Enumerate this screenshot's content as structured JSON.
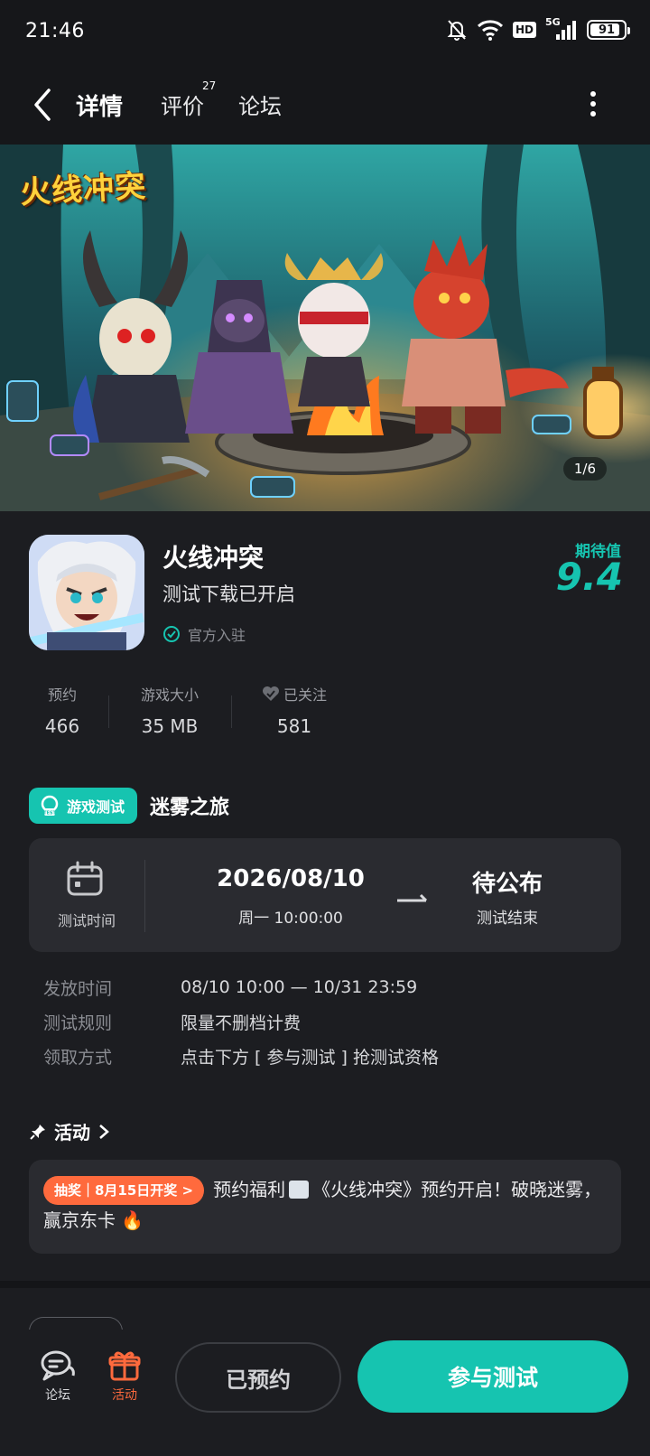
{
  "status_bar": {
    "time": "21:46",
    "network": "5G",
    "hd": "HD",
    "battery": "91"
  },
  "nav": {
    "tabs": [
      {
        "label": "详情",
        "active": true
      },
      {
        "label": "评价",
        "badge": "27"
      },
      {
        "label": "论坛"
      }
    ]
  },
  "banner": {
    "logo_text": "火线冲突",
    "page_indicator": "1/6"
  },
  "game": {
    "name": "火线冲突",
    "tagline": "测试下载已开启",
    "official_label": "官方入驻",
    "expect_label": "期待值",
    "expect_score": "9.4"
  },
  "stats": [
    {
      "label": "预约",
      "value": "466"
    },
    {
      "label": "游戏大小",
      "value": "35 MB"
    },
    {
      "label": "已关注",
      "value": "581"
    }
  ],
  "test": {
    "badge_label": "游戏测试",
    "badge_icon_text": "TEST",
    "name": "迷雾之旅",
    "time_label": "测试时间",
    "start_date": "2026/08/10",
    "start_time": "周一  10:00:00",
    "end_date": "待公布",
    "end_label": "测试结束",
    "rows": [
      {
        "key": "发放时间",
        "value": "08/10 10:00 — 10/31 23:59"
      },
      {
        "key": "测试规则",
        "value": "限量不删档计费"
      },
      {
        "key": "领取方式",
        "value": "点击下方 [ 参与测试 ] 抢测试资格"
      }
    ]
  },
  "activity": {
    "header": "活动",
    "tag": "抽奖｜8月15日开奖 >",
    "text_before": "预约福利",
    "text_after": "《火线冲突》预约开启！破晓迷雾，赢京东卡 🔥"
  },
  "bottom_bar": {
    "forum_label": "论坛",
    "activity_label": "活动",
    "reserved_label": "已预约",
    "join_label": "参与测试"
  },
  "colors": {
    "accent": "#16c4b0",
    "orange": "#ff6a3d",
    "background": "#1c1d21",
    "card": "#2a2b30"
  }
}
